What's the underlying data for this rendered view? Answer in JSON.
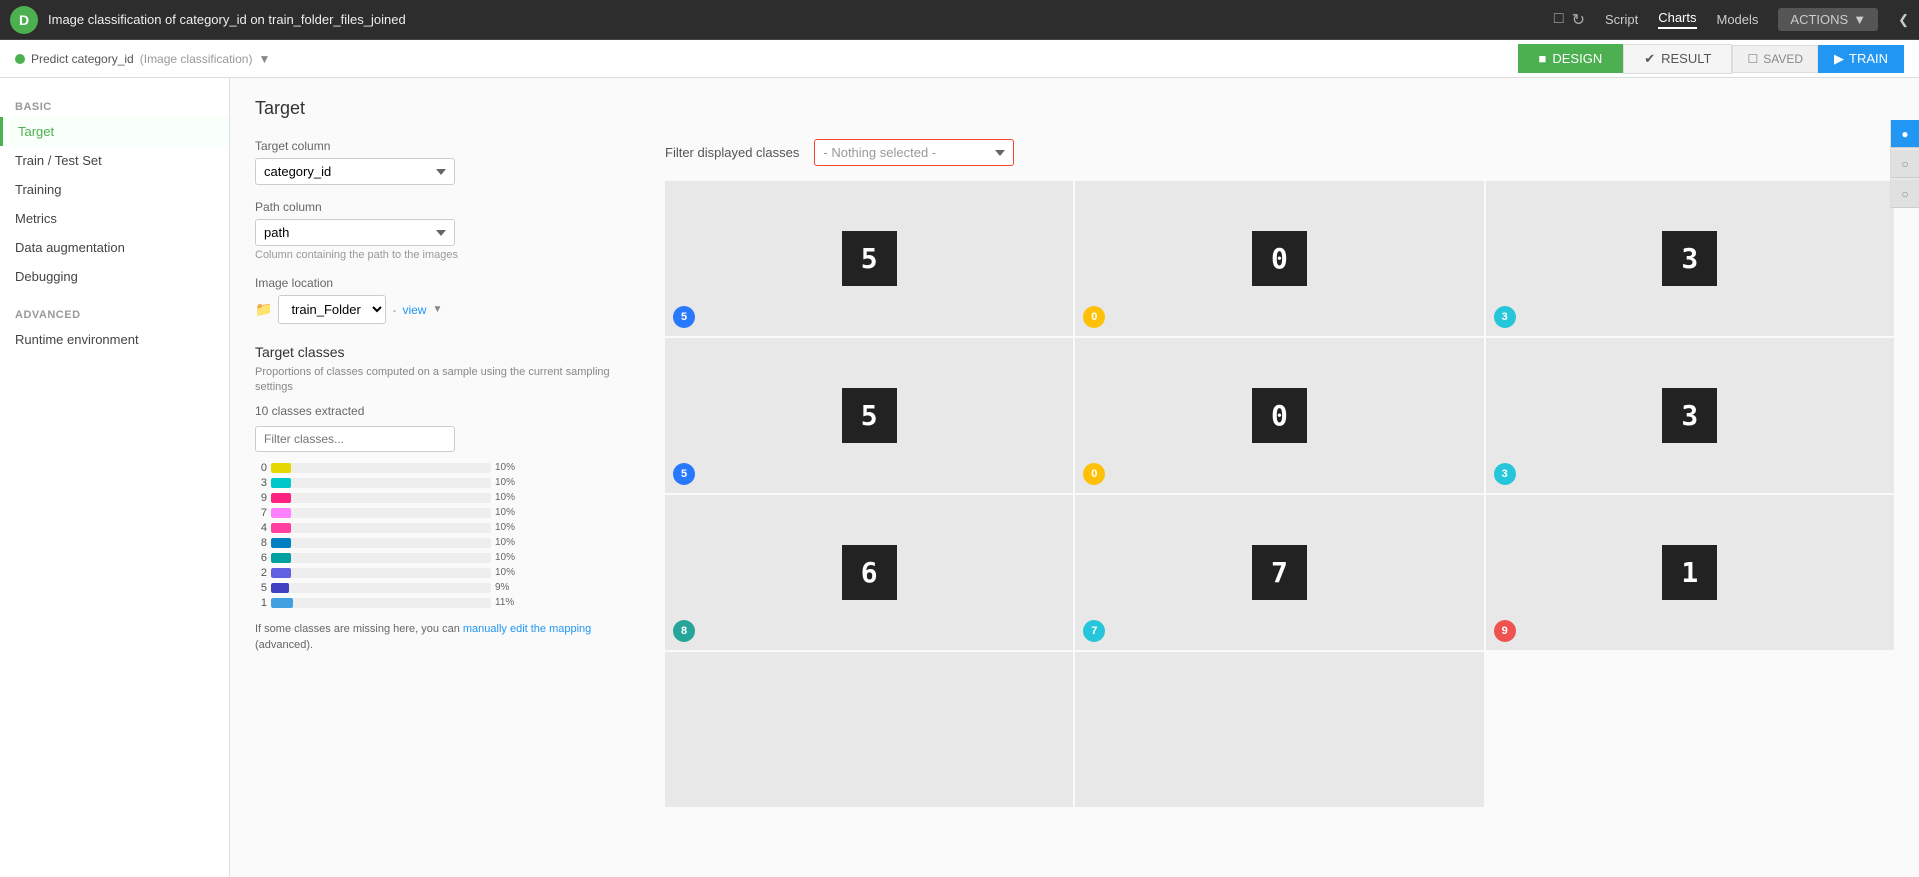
{
  "topbar": {
    "title": "Image classification of category_id on train_folder_files_joined",
    "nav": [
      "Script",
      "Charts",
      "Models",
      "ACTIONS"
    ],
    "active_nav": "Models"
  },
  "secondbar": {
    "predict_label": "Predict category_id",
    "predict_type": "(Image classification)",
    "design_tab": "DESIGN",
    "result_tab": "RESULT",
    "saved_label": "SAVED",
    "train_label": "TRAIN"
  },
  "sidebar": {
    "basic_label": "BASIC",
    "advanced_label": "ADVANCED",
    "items_basic": [
      {
        "id": "target",
        "label": "Target",
        "active": true
      },
      {
        "id": "train-test-set",
        "label": "Train / Test Set",
        "active": false
      },
      {
        "id": "training",
        "label": "Training",
        "active": false
      },
      {
        "id": "metrics",
        "label": "Metrics",
        "active": false
      },
      {
        "id": "data-augmentation",
        "label": "Data augmentation",
        "active": false
      },
      {
        "id": "debugging",
        "label": "Debugging",
        "active": false
      }
    ],
    "items_advanced": [
      {
        "id": "runtime-environment",
        "label": "Runtime environment",
        "active": false
      }
    ]
  },
  "target": {
    "title": "Target",
    "target_column_label": "Target column",
    "target_column_value": "category_id",
    "path_column_label": "Path column",
    "path_column_value": "path",
    "path_column_hint": "Column containing the path to the images",
    "image_location_label": "Image location",
    "image_location_folder": "train_Folder",
    "image_location_view": "view",
    "classes_title": "Target classes",
    "classes_subtitle": "Proportions of classes computed on a sample using the current sampling settings",
    "classes_count": "10 classes extracted",
    "filter_placeholder": "Filter classes...",
    "missing_note_prefix": "If some classes are missing here, you can ",
    "missing_note_link": "manually edit the mapping",
    "missing_note_suffix": " (advanced).",
    "bars": [
      {
        "label": "0",
        "pct": 10,
        "pct_label": "10%",
        "color": "#e5d800"
      },
      {
        "label": "3",
        "pct": 10,
        "pct_label": "10%",
        "color": "#00c8c8"
      },
      {
        "label": "9",
        "pct": 10,
        "pct_label": "10%",
        "color": "#ff2080"
      },
      {
        "label": "7",
        "pct": 10,
        "pct_label": "10%",
        "color": "#ff80ff"
      },
      {
        "label": "4",
        "pct": 10,
        "pct_label": "10%",
        "color": "#ff40a0"
      },
      {
        "label": "8",
        "pct": 10,
        "pct_label": "10%",
        "color": "#0080c0"
      },
      {
        "label": "6",
        "pct": 10,
        "pct_label": "10%",
        "color": "#00a0a0"
      },
      {
        "label": "2",
        "pct": 10,
        "pct_label": "10%",
        "color": "#6060e0"
      },
      {
        "label": "5",
        "pct": 9,
        "pct_label": "9%",
        "color": "#4040c0"
      },
      {
        "label": "1",
        "pct": 11,
        "pct_label": "11%",
        "color": "#40a0e0"
      }
    ]
  },
  "right_panel": {
    "filter_label": "Filter displayed classes",
    "filter_placeholder": "- Nothing selected -",
    "images": [
      {
        "digit": "5",
        "badge": "5",
        "badge_color": "#2979ff"
      },
      {
        "digit": "0",
        "badge": "0",
        "badge_color": "#ffc107"
      },
      {
        "digit": "3",
        "badge": "3",
        "badge_color": "#26c6da"
      },
      {
        "digit": "5",
        "badge": "5",
        "badge_color": "#2979ff"
      },
      {
        "digit": "0",
        "badge": "0",
        "badge_color": "#ffc107"
      },
      {
        "digit": "3",
        "badge": "3",
        "badge_color": "#26c6da"
      },
      {
        "digit": "6",
        "badge": "8",
        "badge_color": "#26a69a"
      },
      {
        "digit": "7",
        "badge": "7",
        "badge_color": "#26c6da"
      },
      {
        "digit": "1",
        "badge": "9",
        "badge_color": "#ef5350"
      },
      {
        "digit": "",
        "badge": "",
        "badge_color": ""
      },
      {
        "digit": "",
        "badge": "",
        "badge_color": ""
      }
    ]
  }
}
